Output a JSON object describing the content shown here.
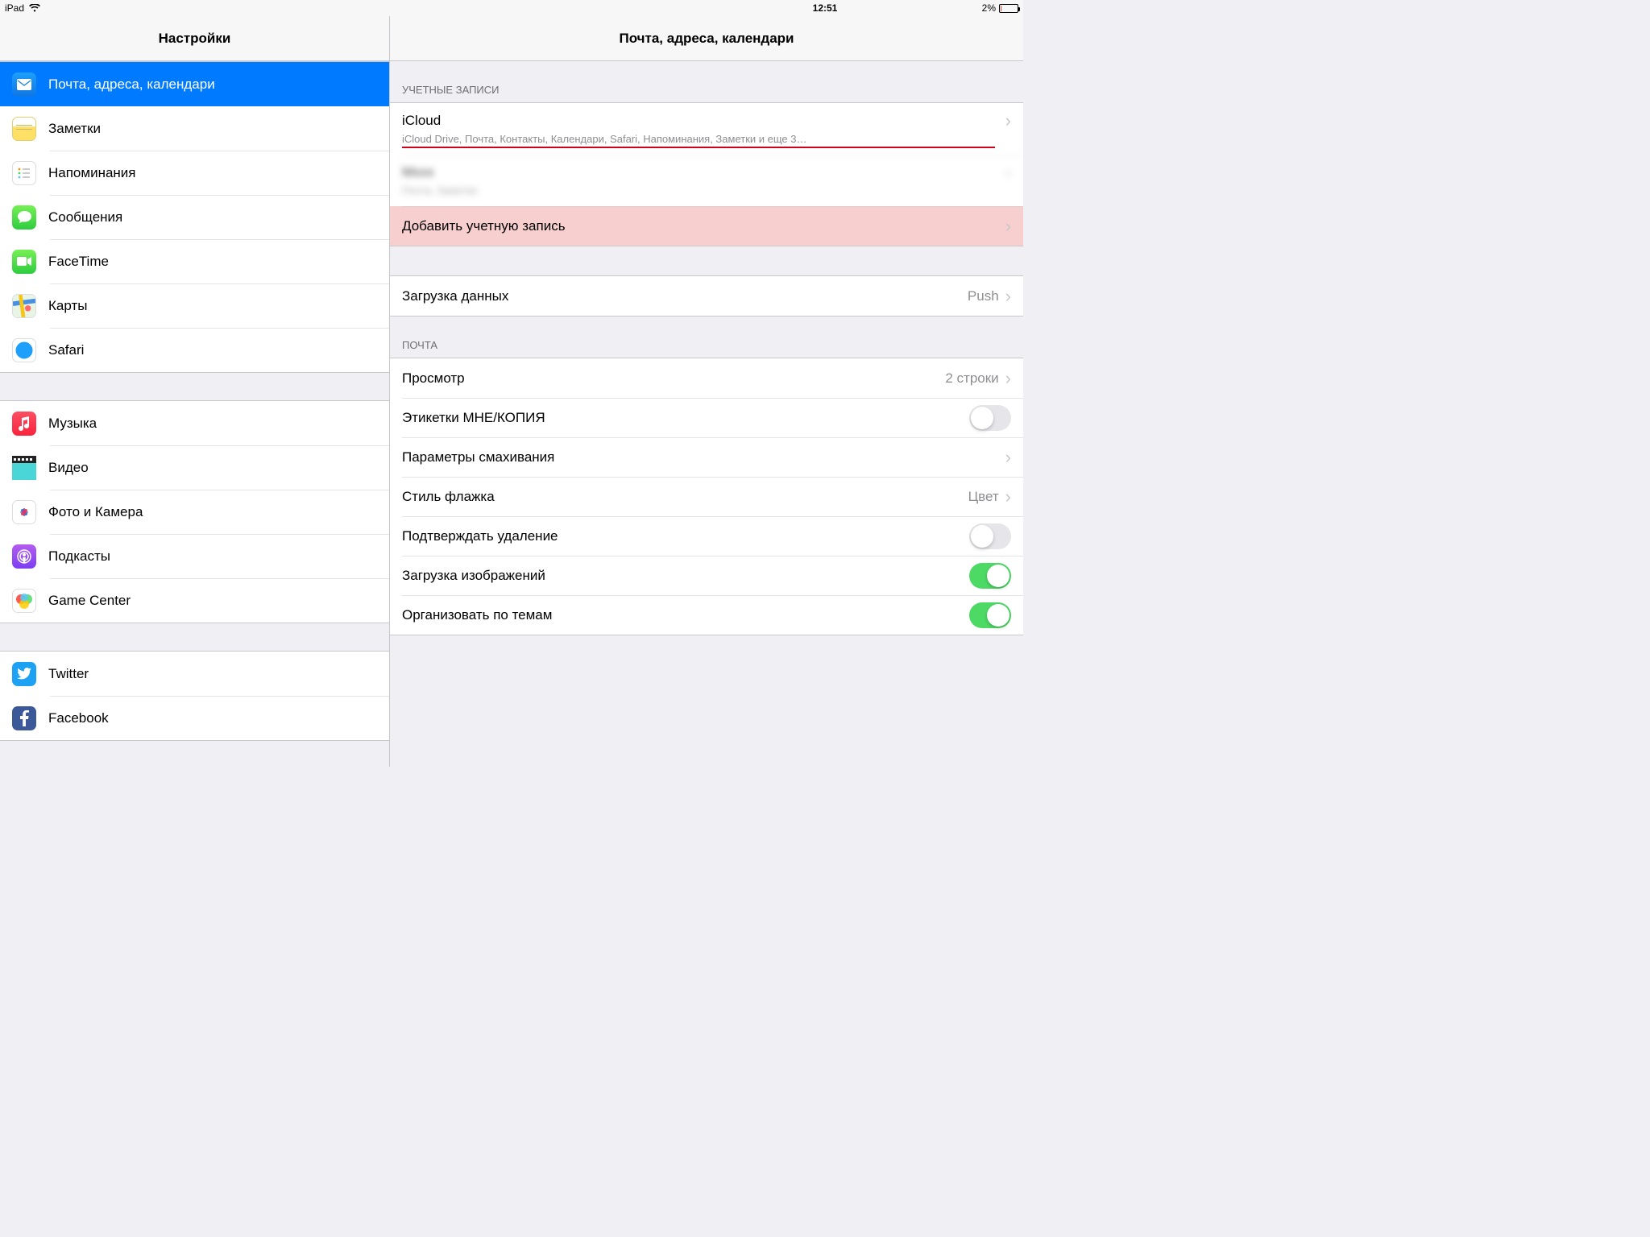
{
  "status": {
    "device": "iPad",
    "time": "12:51",
    "battery_percent": "2%"
  },
  "sidebar": {
    "title": "Настройки",
    "group1": [
      {
        "label": "Почта, адреса, календари",
        "icon": "mail"
      },
      {
        "label": "Заметки",
        "icon": "notes"
      },
      {
        "label": "Напоминания",
        "icon": "reminders"
      },
      {
        "label": "Сообщения",
        "icon": "messages"
      },
      {
        "label": "FaceTime",
        "icon": "facetime"
      },
      {
        "label": "Карты",
        "icon": "maps"
      },
      {
        "label": "Safari",
        "icon": "safari"
      }
    ],
    "group2": [
      {
        "label": "Музыка",
        "icon": "music"
      },
      {
        "label": "Видео",
        "icon": "video"
      },
      {
        "label": "Фото и Камера",
        "icon": "photos"
      },
      {
        "label": "Подкасты",
        "icon": "podcasts"
      },
      {
        "label": "Game Center",
        "icon": "gamecenter"
      }
    ],
    "group3": [
      {
        "label": "Twitter",
        "icon": "twitter"
      },
      {
        "label": "Facebook",
        "icon": "facebook"
      }
    ]
  },
  "detail": {
    "title": "Почта, адреса, календари",
    "accounts_header": "УЧЕТНЫЕ ЗАПИСИ",
    "icloud": {
      "title": "iCloud",
      "subtitle": "iCloud Drive, Почта, Контакты, Календари, Safari, Напоминания, Заметки и еще 3…"
    },
    "second_account": {
      "title": "Mxxx",
      "subtitle": "Почта, Заметки"
    },
    "add_account": "Добавить учетную запись",
    "fetch": {
      "label": "Загрузка данных",
      "value": "Push"
    },
    "mail_header": "ПОЧТА",
    "preview": {
      "label": "Просмотр",
      "value": "2 строки"
    },
    "labels": {
      "label": "Этикетки МНЕ/КОПИЯ"
    },
    "swipe": {
      "label": "Параметры смахивания"
    },
    "flag": {
      "label": "Стиль флажка",
      "value": "Цвет"
    },
    "confirm_delete": {
      "label": "Подтверждать удаление"
    },
    "load_images": {
      "label": "Загрузка изображений"
    },
    "organize": {
      "label": "Организовать по темам"
    }
  }
}
